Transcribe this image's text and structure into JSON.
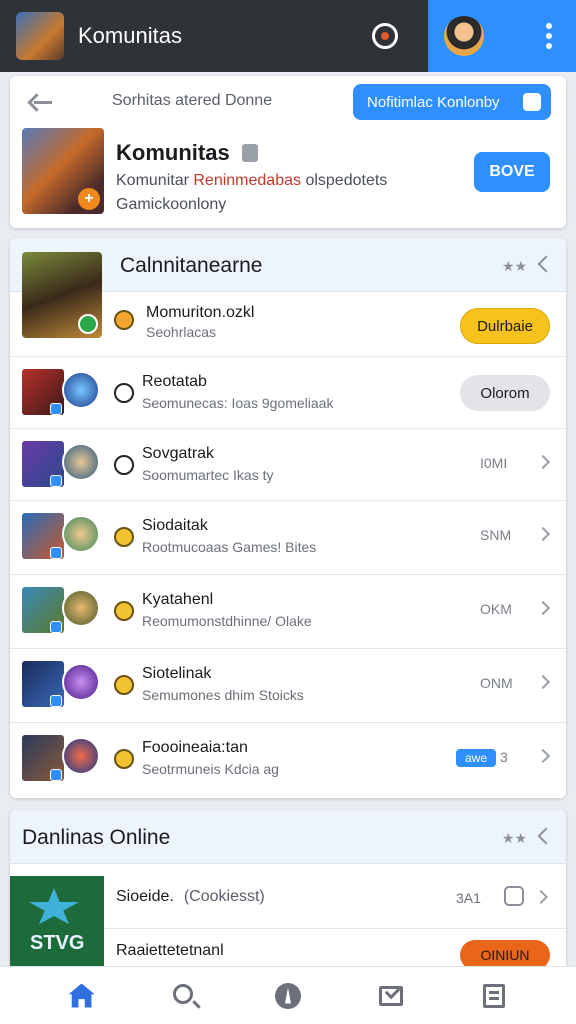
{
  "header": {
    "title": "Komunitas"
  },
  "top_card": {
    "subtitle": "Sorhitas atered Donne",
    "notify_label": "Nofitimlac Konlonby",
    "game_name": "Komunitas",
    "line2_prefix": "Komunitar",
    "line2_highlight": "Reninmedabas",
    "line2_suffix": "olspedotets",
    "line3": "Gamickoonlony",
    "join_label": "BOVE"
  },
  "section_game": {
    "title": "Calnnitanearne",
    "header_stars": "★★",
    "featured": {
      "title": "Momuriton.ozkl",
      "sub": "Seohrlacas",
      "action_label": "Dulrbaie"
    },
    "rows": [
      {
        "title": "Reotatab",
        "sub": "Seomunecas: Ioas 9gomeliaak",
        "action_label": "Olorom"
      },
      {
        "title": "Sovgatrak",
        "sub": "Soomumartec Ikas ty",
        "meta": "I0MI"
      },
      {
        "title": "Siodaitak",
        "sub": "Rootmucoaas Games! Bites",
        "meta": "SNM"
      },
      {
        "title": "Kyatahenl",
        "sub": "Reomumonstdhinne/ Olake",
        "meta": "OKM"
      },
      {
        "title": "Siotelinak",
        "sub": "Semumones dhim Stoicks",
        "meta": "ONM"
      },
      {
        "title": "Foooineaia:tan",
        "sub": "Seotrmuneis Kdcia ag",
        "tag": "awe",
        "meta": "3"
      }
    ]
  },
  "section_online": {
    "title": "Danlinas Online",
    "header_stars": "★★",
    "thumb_text": "STVG",
    "row1_title": "Sioeide.",
    "row1_paren": "(Cookiesst)",
    "row1_meta": "3A1",
    "row2_title": "Raaiettetetnanl",
    "row2_action": "OINIUN"
  },
  "colors": {
    "accent": "#2f8fff",
    "topbar": "#2f3236",
    "yellow": "#f6c21c",
    "orange": "#e8651a"
  },
  "nav": [
    "home-icon",
    "search-icon",
    "compass-icon",
    "inbox-icon",
    "list-icon"
  ]
}
